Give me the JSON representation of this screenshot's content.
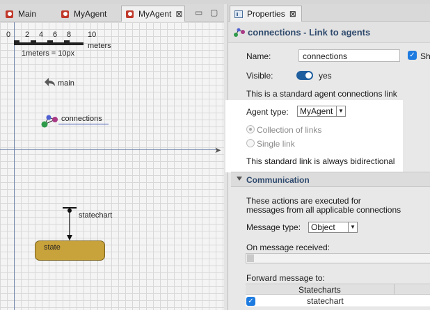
{
  "editor": {
    "tabs": [
      {
        "label": "Main"
      },
      {
        "label": "MyAgent"
      },
      {
        "label": "MyAgent",
        "close": "⊠"
      }
    ],
    "window_controls": {
      "minimize": "▭",
      "maximize": "▢"
    },
    "scale": {
      "ticks": [
        "0",
        "2",
        "4",
        "6",
        "8",
        "10"
      ],
      "unit": "meters",
      "ratio": "1meters = 10px"
    },
    "items": {
      "main": "main",
      "connections": "connections",
      "statechart": "statechart",
      "state": "state"
    }
  },
  "properties": {
    "tab_label": "Properties",
    "tab_close": "⊠",
    "title": "connections - Link to agents",
    "name_label": "Name:",
    "name_value": "connections",
    "show_label": "Sh",
    "visible_label": "Visible:",
    "visible_value": "yes",
    "info_text": "This is a standard agent connections link",
    "agent_type_label": "Agent type:",
    "agent_type_value": "MyAgent",
    "collection_label": "Collection of links",
    "single_label": "Single link",
    "bidirectional_text": "This standard link is always bidirectional",
    "communication": {
      "title": "Communication",
      "desc_line1": "These actions are executed for",
      "desc_line2": "messages from all applicable connections",
      "message_type_label": "Message type:",
      "message_type_value": "Object",
      "on_message_label": "On message received:",
      "forward_label": "Forward message to:",
      "table_header": "Statecharts",
      "table_rows": [
        {
          "checked": true,
          "label": "statechart"
        }
      ]
    }
  },
  "colors": {
    "accent": "#2f4a6d",
    "state_fill": "#c8a23a",
    "toggle_on": "#1f5f9f",
    "checkbox": "#1e7be0"
  }
}
